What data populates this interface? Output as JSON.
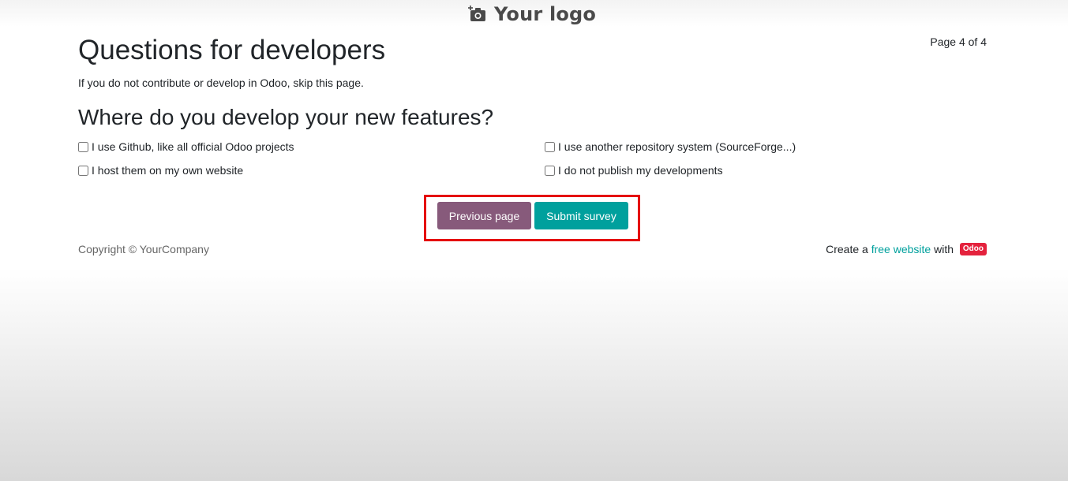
{
  "header": {
    "logo_text": "Your logo",
    "logo_icon": "camera-plus-icon",
    "page_indicator": "Page 4 of 4"
  },
  "page": {
    "title": "Questions for developers",
    "description": "If you do not contribute or develop in Odoo, skip this page."
  },
  "question": {
    "title": "Where do you develop your new features?",
    "choices": [
      {
        "label": "I use Github, like all official Odoo projects",
        "checked": false
      },
      {
        "label": "I use another repository system (SourceForge...)",
        "checked": false
      },
      {
        "label": "I host them on my own website",
        "checked": false
      },
      {
        "label": "I do not publish my developments",
        "checked": false
      }
    ]
  },
  "actions": {
    "previous_label": "Previous page",
    "submit_label": "Submit survey",
    "highlight_color": "#e50000"
  },
  "footer": {
    "copyright": "Copyright © YourCompany",
    "create_prefix": "Create a ",
    "free_website_link": "free website",
    "with_text": " with ",
    "odoo_badge": "Odoo"
  },
  "colors": {
    "previous_button": "#875a7b",
    "submit_button": "#00a09d",
    "link": "#00a09d",
    "odoo_badge": "#e4223d"
  }
}
